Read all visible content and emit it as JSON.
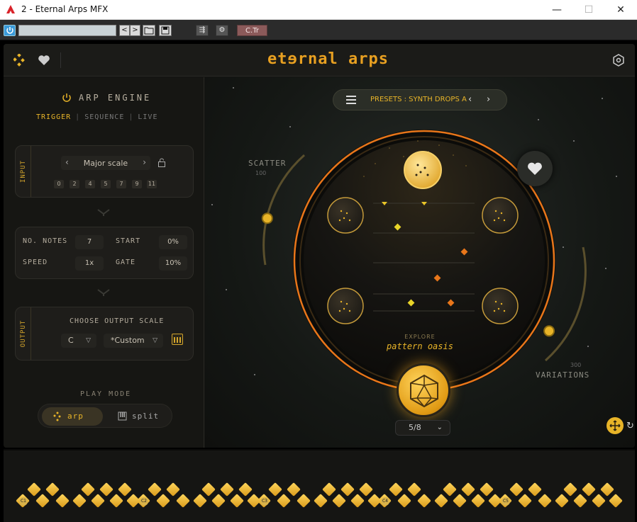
{
  "window": {
    "title": "2 - Eternal Arps MFX",
    "minimize": "—",
    "maximize": "☐",
    "close": "✕"
  },
  "host": {
    "preset_value": "",
    "ctr_label": "C.Tr",
    "prev": "<",
    "next": ">"
  },
  "header": {
    "logo": "etɘrnal arps"
  },
  "engine": {
    "title": "ARP ENGINE",
    "tabs": [
      "TRIGGER",
      "SEQUENCE",
      "LIVE"
    ],
    "active_tab": "TRIGGER"
  },
  "input": {
    "label": "INPUT",
    "scale": "Major scale",
    "notes": [
      "0",
      "2",
      "4",
      "5",
      "7",
      "9",
      "11"
    ]
  },
  "params": {
    "no_notes_label": "NO. NOTES",
    "no_notes": "7",
    "start_label": "START",
    "start": "0%",
    "speed_label": "SPEED",
    "speed": "1x",
    "gate_label": "GATE",
    "gate": "10%"
  },
  "output": {
    "label": "OUTPUT",
    "title": "CHOOSE OUTPUT SCALE",
    "key": "C",
    "scale": "*Custom"
  },
  "play_mode": {
    "title": "PLAY MODE",
    "options": [
      "arp",
      "split"
    ],
    "selected": "arp"
  },
  "main": {
    "presets": "PRESETS : SYNTH DROPS A",
    "scatter_label": "SCATTER",
    "scatter_value": "100",
    "scatter_level": 0.55,
    "variations_label": "VARIATIONS",
    "variations_value": "300",
    "variations_level": 0.3,
    "explore_small": "EXPLORE",
    "explore_name": "pattern oasis",
    "pager": "5/8"
  },
  "keyboard": {
    "octaves": [
      "C1",
      "C2",
      "C3",
      "C4",
      "C5"
    ]
  },
  "colors": {
    "accent": "#e8b428",
    "orange": "#e8761a",
    "bg": "#141412"
  }
}
